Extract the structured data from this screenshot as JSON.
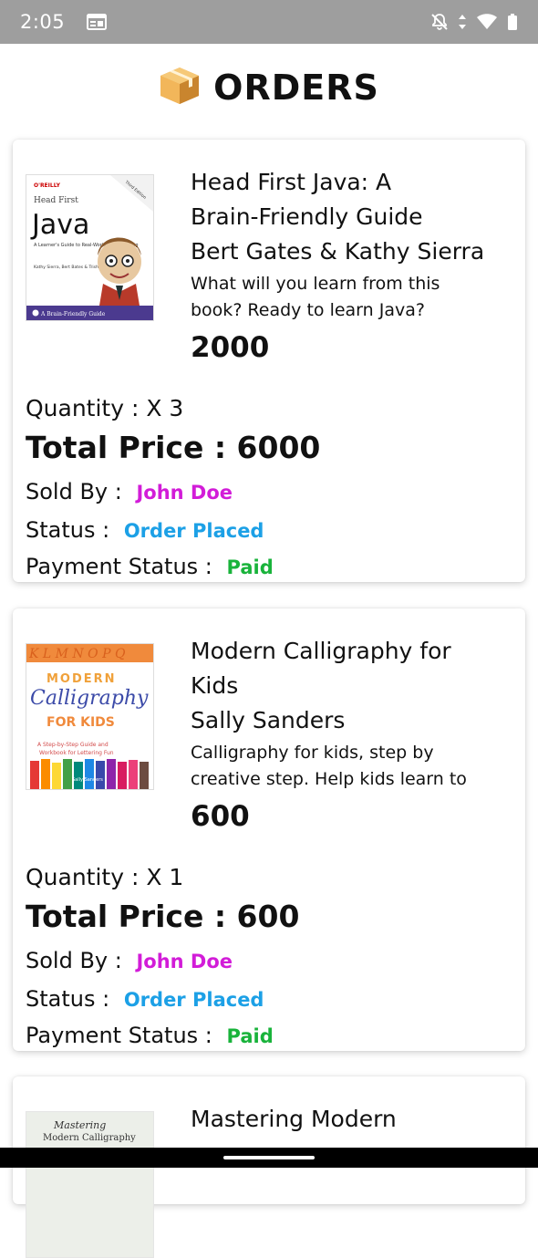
{
  "status_bar": {
    "time": "2:05",
    "icons": [
      "browser-icon",
      "notifications-off-icon",
      "data-arrows-icon",
      "wifi-icon",
      "battery-icon"
    ]
  },
  "header": {
    "icon": "package-icon",
    "title": "ORDERS"
  },
  "labels": {
    "quantity": "Quantity : ",
    "total_price": "Total Price : ",
    "sold_by": "Sold By : ",
    "status": "Status : ",
    "payment_status": "Payment Status : "
  },
  "orders": [
    {
      "title_line1": "Head First Java: A",
      "title_line2": "Brain-Friendly Guide",
      "author": "Bert Gates & Kathy Sierra",
      "desc_line1": "What will you learn from this",
      "desc_line2": "book? Ready to learn Java?",
      "price": "2000",
      "quantity": "X 3",
      "total_price": "6000",
      "seller": "John Doe",
      "status": "Order Placed",
      "payment_status": "Paid",
      "cover": {
        "publisher": "O'REILLY",
        "series": "Head First",
        "name": "Java",
        "subtitle": "A Learner's Guide to Real-World Programming",
        "edition": "Third Edition",
        "authors": "Kathy Sierra, Bert Bates & Trisha Gee",
        "footer": "A Brain-Friendly Guide"
      }
    },
    {
      "title_line1": "Modern Calligraphy for",
      "title_line2": "Kids",
      "author": "Sally Sanders",
      "desc_line1": "Calligraphy for kids, step by",
      "desc_line2": "creative step. Help kids learn to",
      "price": "600",
      "quantity": "X 1",
      "total_price": "600",
      "seller": "John Doe",
      "status": "Order Placed",
      "payment_status": "Paid",
      "cover": {
        "top_letters": "K L M N O P Q",
        "line1": "MODERN",
        "line2": "Calligraphy",
        "line3": "FOR KIDS",
        "tagline_a": "A Step-by-Step Guide and",
        "tagline_b": "Workbook for Lettering Fun",
        "author": "Sally Sanders"
      }
    },
    {
      "title_line1": "Mastering Modern",
      "cover": {
        "line1": "Mastering",
        "line2": "Modern Calligraphy"
      }
    }
  ],
  "colors": {
    "status_bar": "#9e9e9e",
    "seller": "#d21cd8",
    "order_status": "#1ca0e6",
    "payment_status": "#19b33b"
  }
}
